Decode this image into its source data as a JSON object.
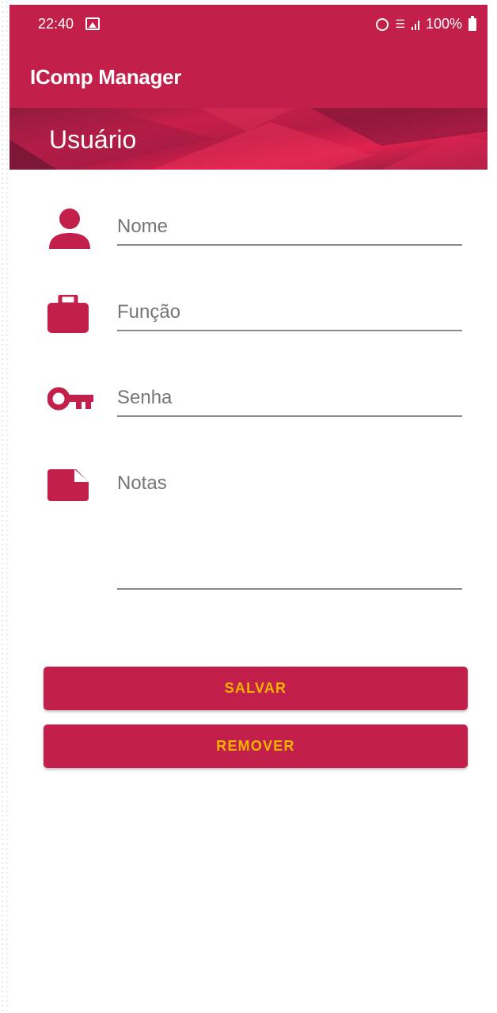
{
  "status_bar": {
    "time": "22:40",
    "battery": "100%",
    "icons": [
      "image-icon",
      "alarm-icon",
      "wifi-icon",
      "signal-icon",
      "battery-icon"
    ]
  },
  "app_bar": {
    "title": "IComp Manager"
  },
  "banner": {
    "heading": "Usuário"
  },
  "form": {
    "nome": {
      "placeholder": "Nome",
      "icon": "person-icon"
    },
    "funcao": {
      "placeholder": "Função",
      "icon": "briefcase-icon"
    },
    "senha": {
      "placeholder": "Senha",
      "icon": "key-icon"
    },
    "notas": {
      "placeholder": "Notas",
      "icon": "note-icon"
    }
  },
  "buttons": {
    "save_label": "SALVAR",
    "remove_label": "REMOVER"
  },
  "colors": {
    "primary": "#c2204b",
    "accent_text": "#f4b400",
    "hint": "#9e9e9e"
  }
}
